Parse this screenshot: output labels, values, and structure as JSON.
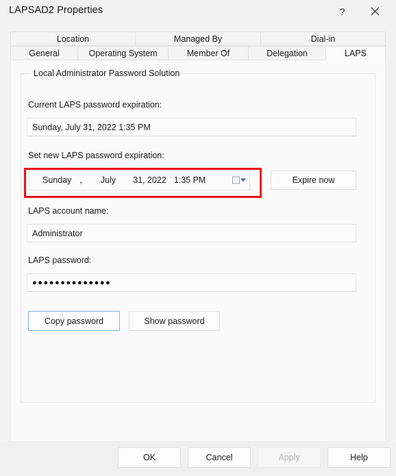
{
  "window": {
    "title": "LAPSAD2 Properties",
    "help_icon": "question-mark-icon",
    "close_icon": "close-icon"
  },
  "tabs": {
    "row1": [
      {
        "label": "Location",
        "active": false
      },
      {
        "label": "Managed By",
        "active": false
      },
      {
        "label": "Dial-in",
        "active": false
      }
    ],
    "row2": [
      {
        "label": "General",
        "active": false
      },
      {
        "label": "Operating System",
        "active": false
      },
      {
        "label": "Member Of",
        "active": false
      },
      {
        "label": "Delegation",
        "active": false
      },
      {
        "label": "LAPS",
        "active": true
      }
    ]
  },
  "laps": {
    "group_title": "Local Administrator Password Solution",
    "current_expiration_label": "Current LAPS password expiration:",
    "current_expiration_value": "Sunday, July 31, 2022 1:35 PM",
    "set_expiration_label": "Set new LAPS password expiration:",
    "datepicker": {
      "weekday": "Sunday",
      "comma": ",",
      "month": "July",
      "day_year": "31, 2022",
      "time": "1:35 PM",
      "dropdown_icon": "calendar-dropdown-icon"
    },
    "expire_now_label": "Expire now",
    "account_name_label": "LAPS account name:",
    "account_name_value": "Administrator",
    "password_label": "LAPS password:",
    "password_value": "●●●●●●●●●●●●●●",
    "copy_password_label": "Copy password",
    "show_password_label": "Show password"
  },
  "annotation": {
    "highlight_color": "#ee1111",
    "target": "datepicker"
  },
  "footer": {
    "ok_label": "OK",
    "cancel_label": "Cancel",
    "apply_label": "Apply",
    "help_label": "Help"
  }
}
